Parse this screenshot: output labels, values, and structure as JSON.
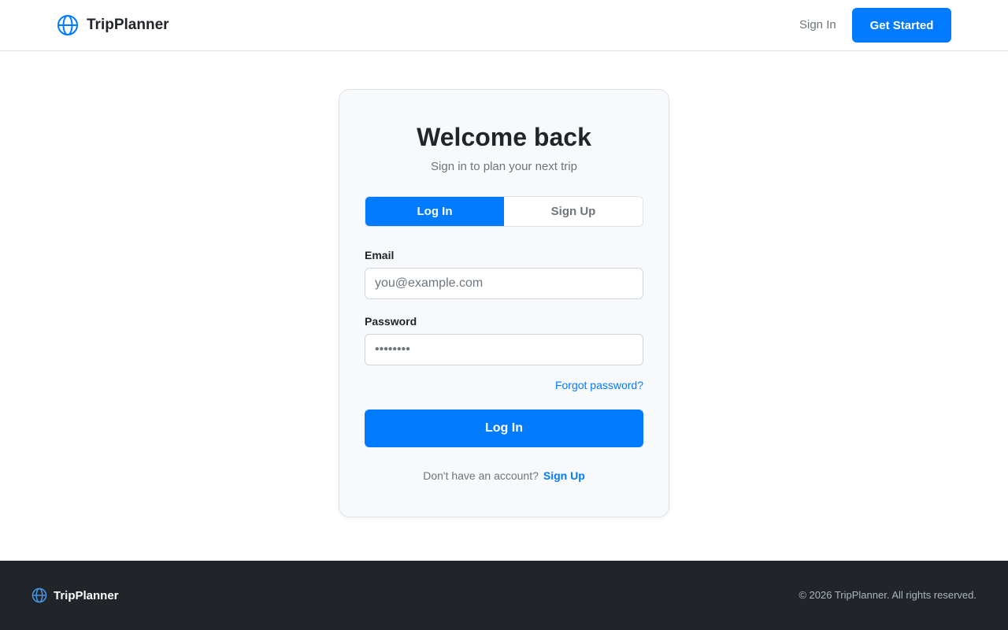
{
  "header": {
    "brand_name": "TripPlanner",
    "nav_sign_in": "Sign In",
    "get_started": "Get Started"
  },
  "card": {
    "title": "Welcome back",
    "subtitle": "Sign in to plan your next trip",
    "tabs": [
      {
        "label": "Log In",
        "active": true
      },
      {
        "label": "Sign Up",
        "active": false
      }
    ],
    "email": {
      "label": "Email",
      "placeholder": "you@example.com",
      "value": ""
    },
    "password": {
      "label": "Password",
      "placeholder": "••••••••",
      "value": ""
    },
    "forgot_password": "Forgot password?",
    "submit_label": "Log In",
    "no_account_text": "Don't have an account?",
    "signup_link": "Sign Up"
  },
  "footer": {
    "brand_name": "TripPlanner",
    "copyright": "© 2026 TripPlanner. All rights reserved."
  },
  "icons": {
    "brand": "globe-icon",
    "footer_brand": "globe-icon"
  },
  "colors": {
    "accent": "#007bff",
    "footer_bg": "#212529",
    "card_bg": "#f8f9fa"
  }
}
